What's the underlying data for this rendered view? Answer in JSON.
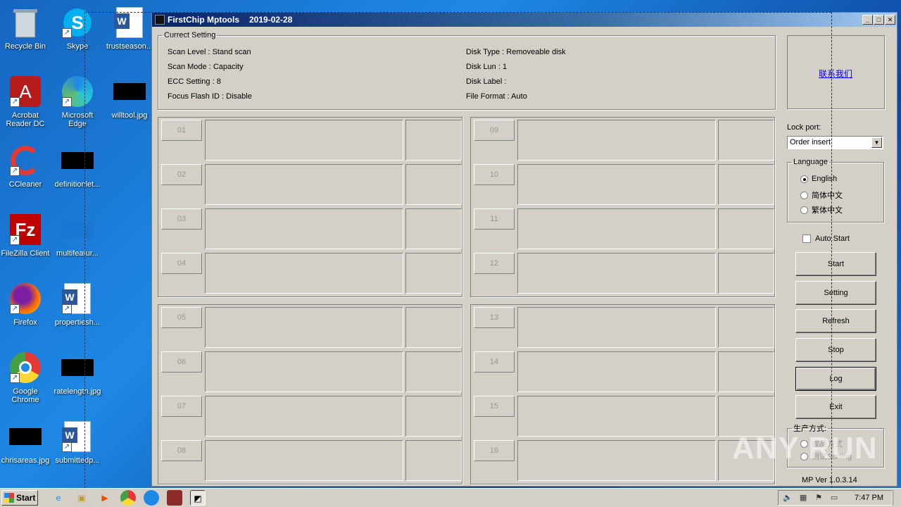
{
  "desktop": {
    "icons": [
      {
        "label": "Recycle Bin",
        "icon": "recycle-bin-icon"
      },
      {
        "label": "Skype",
        "icon": "skype-icon"
      },
      {
        "label": "trustseason...",
        "icon": "word-doc-icon"
      },
      {
        "label": "Acrobat Reader DC",
        "icon": "acrobat-icon"
      },
      {
        "label": "Microsoft Edge",
        "icon": "edge-icon"
      },
      {
        "label": "willtool.jpg",
        "icon": "image-file-icon"
      },
      {
        "label": "CCleaner",
        "icon": "ccleaner-icon"
      },
      {
        "label": "definitionlet...",
        "icon": "image-file-icon"
      },
      {
        "label": "FileZilla Client",
        "icon": "filezilla-icon"
      },
      {
        "label": "multifeatur...",
        "icon": "image-file-icon"
      },
      {
        "label": "Firefox",
        "icon": "firefox-icon"
      },
      {
        "label": "propertiesh...",
        "icon": "word-doc-icon"
      },
      {
        "label": "Google Chrome",
        "icon": "chrome-icon"
      },
      {
        "label": "ratelength.jpg",
        "icon": "image-file-icon"
      },
      {
        "label": "chrisareas.jpg",
        "icon": "image-file-icon"
      },
      {
        "label": "submittedp...",
        "icon": "word-doc-icon"
      }
    ]
  },
  "window": {
    "title": "FirstChip Mptools",
    "date": "2019-02-28",
    "minimize": "_",
    "maximize": "□",
    "close": "✕"
  },
  "current_setting": {
    "legend": "Currect Setting",
    "scan_level": "Scan Level : Stand scan",
    "scan_mode": "Scan Mode : Capacity",
    "ecc_setting": "ECC Setting : 8",
    "focus_flash": "Focus Flash ID : Disable",
    "disk_type": "Disk Type : Removeable disk",
    "disk_lun": "Disk Lun : 1",
    "disk_label": "Disk Label :",
    "file_format": "File Format : Auto"
  },
  "ports": [
    "01",
    "02",
    "03",
    "04",
    "05",
    "06",
    "07",
    "08",
    "09",
    "10",
    "11",
    "12",
    "13",
    "14",
    "15",
    "16"
  ],
  "contact_link": "联系我们",
  "lock_port": {
    "label": "Lock port:",
    "value": "Order insert",
    "arrow": "▼"
  },
  "language": {
    "legend": "Language",
    "options": [
      "English",
      "简体中文",
      "繁体中文"
    ],
    "selected": "English"
  },
  "auto_start": "Auto Start",
  "buttons": {
    "start": "Start",
    "setting": "Setting",
    "refresh": "Refresh",
    "stop": "Stop",
    "log": "Log",
    "exit": "Exit"
  },
  "production": {
    "legend": "生产方式:",
    "options": [
      "成品方式",
      "测试Sorting"
    ]
  },
  "mp_version": "MP Ver 1.0.3.14",
  "watermark": "ANY RUN",
  "taskbar": {
    "start_label": "Start",
    "clock": "7:47 PM"
  },
  "colors": {
    "window_bg": "#d4d0c8",
    "title_start": "#0a246a",
    "link": "#0000ee"
  }
}
